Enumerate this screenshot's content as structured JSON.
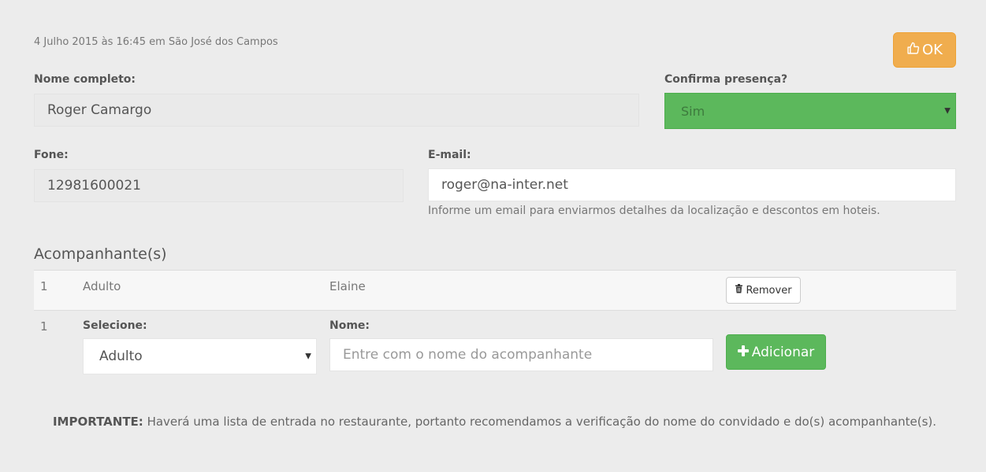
{
  "header": {
    "timestamp": "4 Julho 2015 às 16:45 em São José dos Campos",
    "ok_label": "OK"
  },
  "form": {
    "full_name": {
      "label": "Nome completo:",
      "value": "Roger Camargo"
    },
    "presence": {
      "label": "Confirma presença?",
      "selected": "Sim"
    },
    "phone": {
      "label": "Fone:",
      "value": "12981600021"
    },
    "email": {
      "label": "E-mail:",
      "value": "roger@na-inter.net",
      "help": "Informe um email para enviarmos detalhes da localização e descontos em hoteis."
    }
  },
  "companions": {
    "title": "Acompanhante(s)",
    "rows": [
      {
        "index": "1",
        "type": "Adulto",
        "name": "Elaine",
        "remove_label": "Remover"
      }
    ],
    "new_row": {
      "index": "1",
      "select_label": "Selecione:",
      "select_value": "Adulto",
      "name_label": "Nome:",
      "name_placeholder": "Entre com o nome do acompanhante",
      "add_label": "Adicionar"
    }
  },
  "notice": {
    "bold": "IMPORTANTE:",
    "text": " Haverá uma lista de entrada no restaurante, portanto recomendamos a verificação do nome do convidado e do(s) acompanhante(s)."
  },
  "colors": {
    "warning": "#f0ad4e",
    "success": "#5cb85c",
    "background": "#ececec"
  },
  "icons": [
    "thumbs-up-icon",
    "trash-icon",
    "plus-icon",
    "caret-down-icon"
  ]
}
